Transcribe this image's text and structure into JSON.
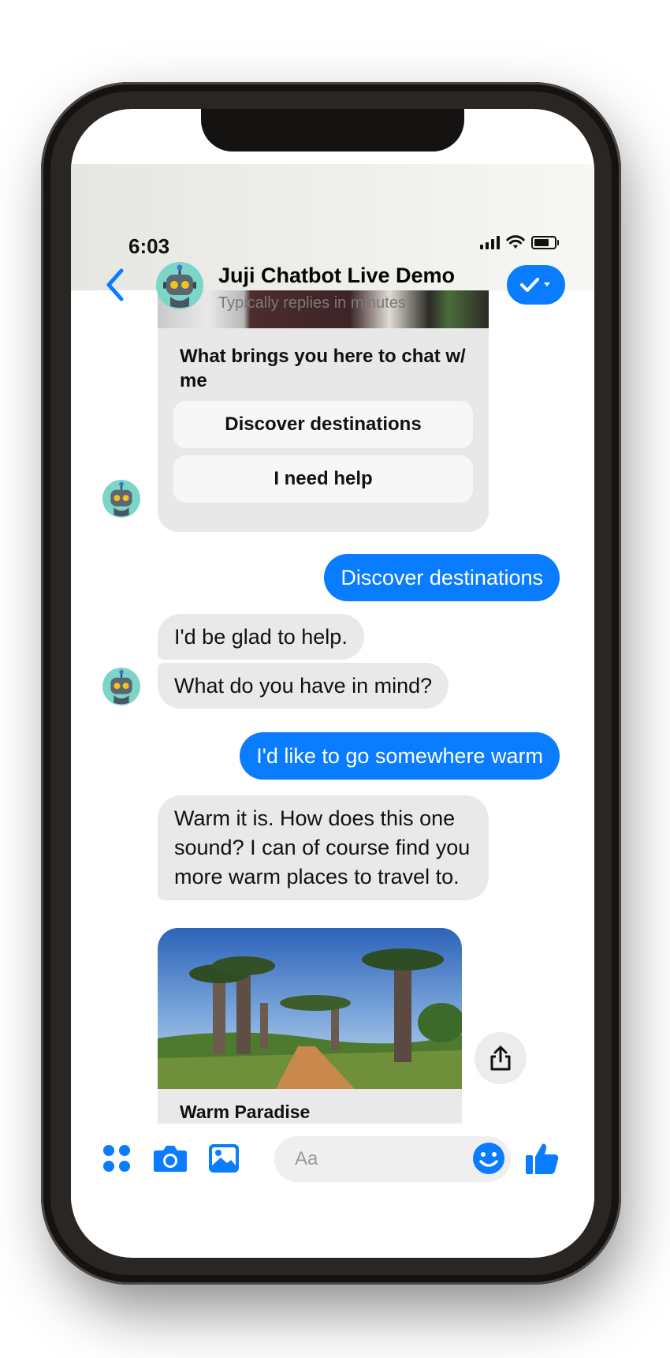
{
  "status_bar": {
    "time": "6:03"
  },
  "header": {
    "title": "Juji Chatbot Live Demo",
    "subtitle": "Typically replies in minutes",
    "back_icon": "chevron-left-icon",
    "done_icon": "checkmark-dropdown-icon"
  },
  "messages": {
    "card": {
      "title": "What brings you here to chat w/ me",
      "buttons": [
        "Discover destinations",
        "I need help"
      ]
    },
    "user_1": "Discover destinations",
    "bot_1": "I'd be glad to help.",
    "bot_2": "What do you have in mind?",
    "user_2": "I'd like to go somewhere warm",
    "bot_3": "Warm it is. How does this one sound? I can of course find you more warm places to travel to.",
    "travel_card": {
      "title": "Warm Paradise",
      "image": "baobab-avenue-photo"
    }
  },
  "composer": {
    "placeholder": "Aa",
    "icons": [
      "apps-grid-icon",
      "camera-icon",
      "gallery-icon",
      "emoji-icon",
      "thumbs-up-icon"
    ]
  },
  "colors": {
    "accent": "#0a7cff",
    "bubble_in": "#e9e9e9",
    "bubble_out": "#0a7cff"
  }
}
